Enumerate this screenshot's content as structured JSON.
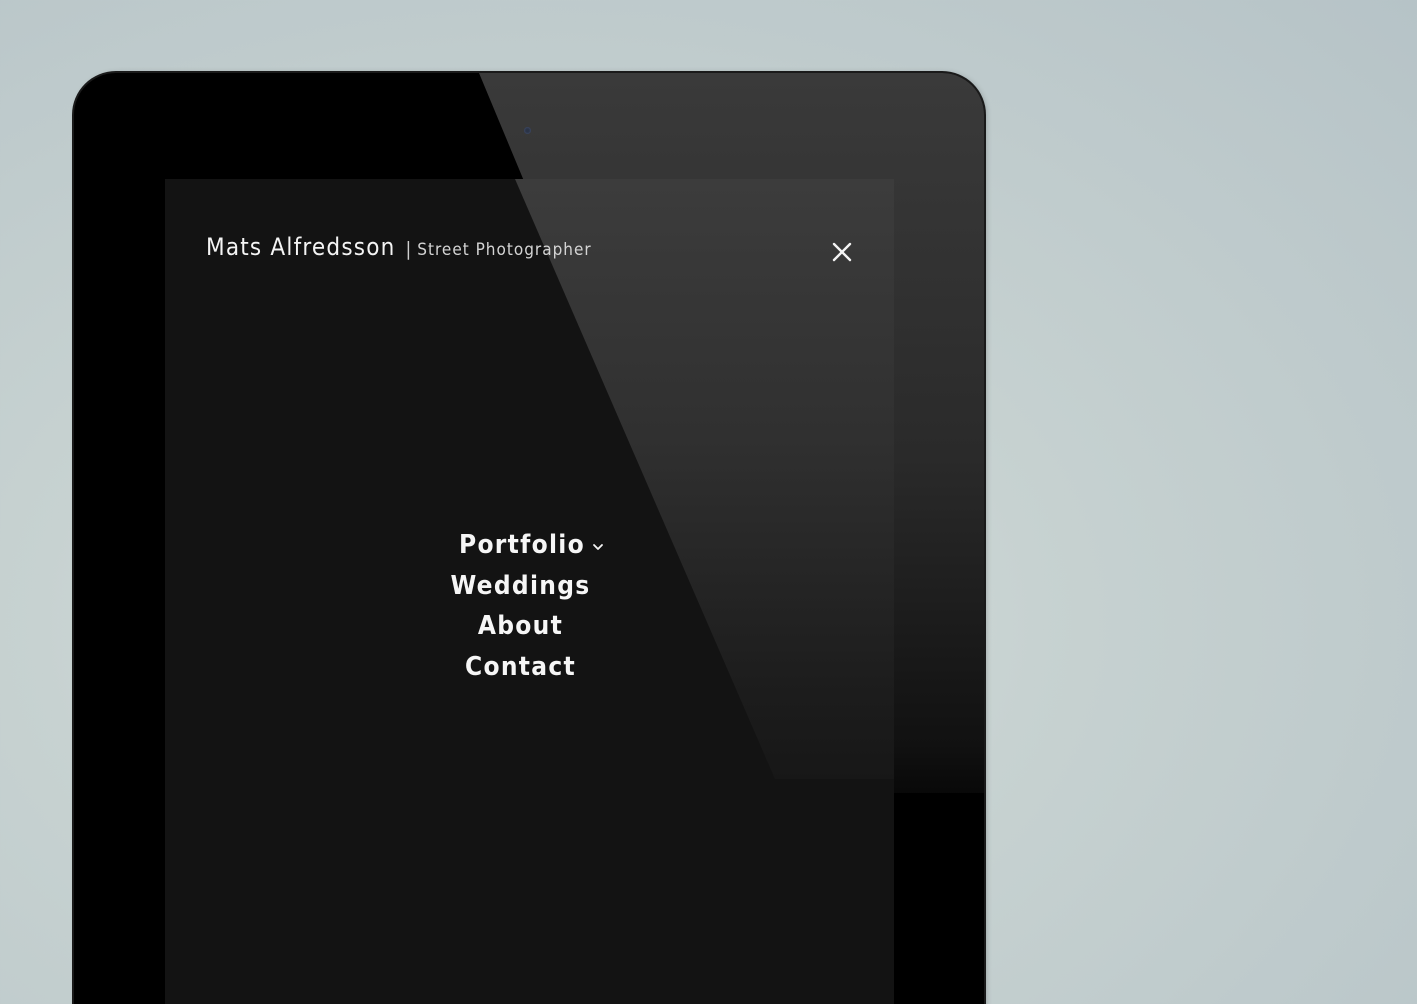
{
  "site": {
    "name": "Mats Alfredsson",
    "separator": "|",
    "tagline": "Street Photographer"
  },
  "header": {
    "close_icon": "close-icon"
  },
  "menu": {
    "items": [
      {
        "label": "Portfolio",
        "icon": "chevron-down-icon"
      },
      {
        "label": "Weddings"
      },
      {
        "label": "About"
      },
      {
        "label": "Contact"
      }
    ]
  },
  "colors": {
    "background": "#c4cfce",
    "device": "#000000",
    "screen": "#131313",
    "text": "#f4f4f4"
  }
}
